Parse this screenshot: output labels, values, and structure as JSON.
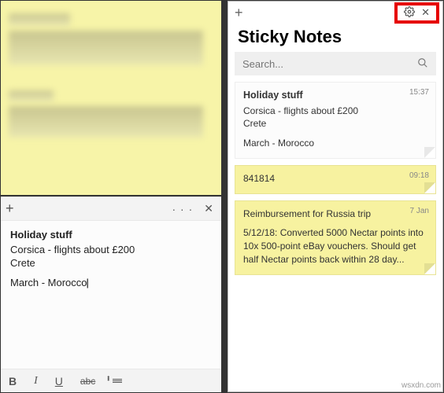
{
  "left_note": {
    "toolbar": {
      "plus": "+",
      "menu": "· · ·",
      "close": "✕"
    },
    "title": "Holiday stuff",
    "line1": "Corsica - flights about £200",
    "line2": "Crete",
    "line3": "March - Morocco",
    "format": {
      "bold": "B",
      "italic": "I",
      "under": "U",
      "strike": "abc"
    }
  },
  "app": {
    "title": "Sticky Notes",
    "plus": "+",
    "close": "✕",
    "search_placeholder": "Search..."
  },
  "notes": [
    {
      "time": "15:37",
      "title": "Holiday stuff",
      "body1": "Corsica - flights about £200",
      "body2": "Crete",
      "body3": "March - Morocco",
      "color": "white"
    },
    {
      "time": "09:18",
      "title": "841814",
      "color": "yellow"
    },
    {
      "time": "7 Jan",
      "title": "Reimbursement for Russia trip",
      "body1": "5/12/18: Converted 5000 Nectar points into 10x 500-point eBay vouchers. Should get half Nectar points back within 28 day...",
      "color": "yellow"
    }
  ],
  "watermark": "wsxdn.com"
}
